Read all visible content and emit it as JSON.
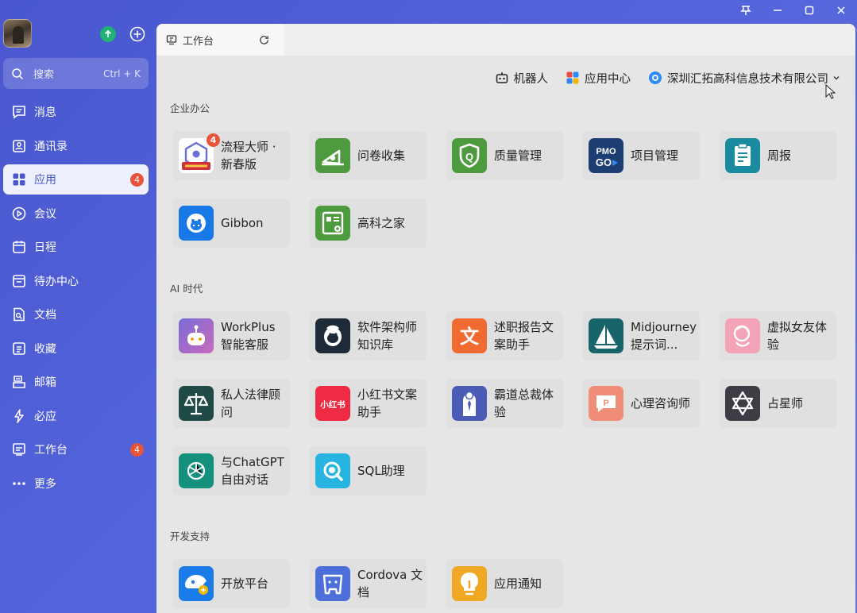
{
  "window": {
    "controls": [
      "pin",
      "minimize",
      "maximize",
      "close"
    ]
  },
  "sidebar": {
    "search": {
      "placeholder": "搜索",
      "shortcut": "Ctrl + K"
    },
    "items": [
      {
        "label": "消息",
        "icon": "message-icon"
      },
      {
        "label": "通讯录",
        "icon": "contacts-icon"
      },
      {
        "label": "应用",
        "icon": "apps-icon",
        "badge": "4",
        "active": true
      },
      {
        "label": "会议",
        "icon": "meeting-icon"
      },
      {
        "label": "日程",
        "icon": "calendar-icon"
      },
      {
        "label": "待办中心",
        "icon": "todo-icon"
      },
      {
        "label": "文档",
        "icon": "document-icon"
      },
      {
        "label": "收藏",
        "icon": "favorites-icon"
      },
      {
        "label": "邮箱",
        "icon": "mail-icon"
      },
      {
        "label": "必应",
        "icon": "ding-icon"
      },
      {
        "label": "工作台",
        "icon": "workbench-icon",
        "badge": "4"
      },
      {
        "label": "更多",
        "icon": "more-icon"
      }
    ]
  },
  "tab": {
    "label": "工作台"
  },
  "toolbar": {
    "robot": "机器人",
    "app_center": "应用中心",
    "company": "深圳汇拓高科信息技术有限公司"
  },
  "sections": [
    {
      "title": "企业办公",
      "apps": [
        {
          "name": "流程大师 · 新春版",
          "icon": "workflow-master-icon",
          "color": "#ffffff",
          "badge": "4"
        },
        {
          "name": "问卷收集",
          "icon": "survey-icon",
          "color": "#4e9a3e"
        },
        {
          "name": "质量管理",
          "icon": "quality-icon",
          "color": "#4e9a3e"
        },
        {
          "name": "项目管理",
          "icon": "pmo-go-icon",
          "color": "#1d3e72"
        },
        {
          "name": "周报",
          "icon": "weekly-report-icon",
          "color": "#1a8aa0"
        },
        {
          "name": "Gibbon",
          "icon": "gibbon-icon",
          "color": "#1778e6"
        },
        {
          "name": "高科之家",
          "icon": "home-card-icon",
          "color": "#4e9a3e"
        }
      ]
    },
    {
      "title": "AI 时代",
      "apps": [
        {
          "name": "WorkPlus 智能客服",
          "icon": "ai-bot-icon",
          "color": "#7c6fd6"
        },
        {
          "name": "软件架构师知识库",
          "icon": "mailchimp-icon",
          "color": "#1e2a38"
        },
        {
          "name": "述职报告文案助手",
          "icon": "wen-icon",
          "color": "#f16a2f"
        },
        {
          "name": "Midjourney 提示词...",
          "icon": "sailboat-icon",
          "color": "#17646b"
        },
        {
          "name": "虚拟女友体验",
          "icon": "girlfriend-icon",
          "color": "#f3a3b6"
        },
        {
          "name": "私人法律顾问",
          "icon": "scales-icon",
          "color": "#1f4a45"
        },
        {
          "name": "小红书文案助手",
          "icon": "xiaohongshu-icon",
          "color": "#ee2b43"
        },
        {
          "name": "霸道总裁体验",
          "icon": "ceo-icon",
          "color": "#4a5cb5"
        },
        {
          "name": "心理咨询师",
          "icon": "chat-p-icon",
          "color": "#f08d79"
        },
        {
          "name": "占星师",
          "icon": "star-of-david-icon",
          "color": "#3d3d45"
        },
        {
          "name": "与ChatGPT自由对话",
          "icon": "chatgpt-icon",
          "color": "#14917c"
        },
        {
          "name": "SQL助理",
          "icon": "sql-search-icon",
          "color": "#28b4e0"
        }
      ]
    },
    {
      "title": "开发支持",
      "apps": [
        {
          "name": "开放平台",
          "icon": "open-platform-icon",
          "color": "#1b7be8"
        },
        {
          "name": "Cordova 文档",
          "icon": "cordova-icon",
          "color": "#4e6fd9"
        },
        {
          "name": "应用通知",
          "icon": "lightbulb-icon",
          "color": "#f0a824"
        }
      ]
    }
  ]
}
